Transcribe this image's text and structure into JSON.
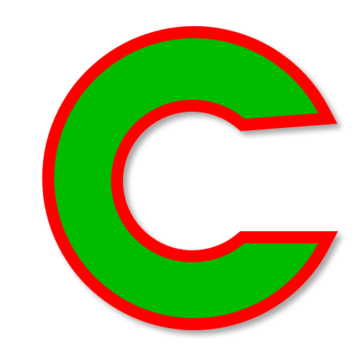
{
  "logo": {
    "icon": "letter-c-logo-icon",
    "colors": {
      "outline": "#ff0000",
      "fill": "#00bb00",
      "background": "#ffffff",
      "shadow": "#000000"
    }
  }
}
